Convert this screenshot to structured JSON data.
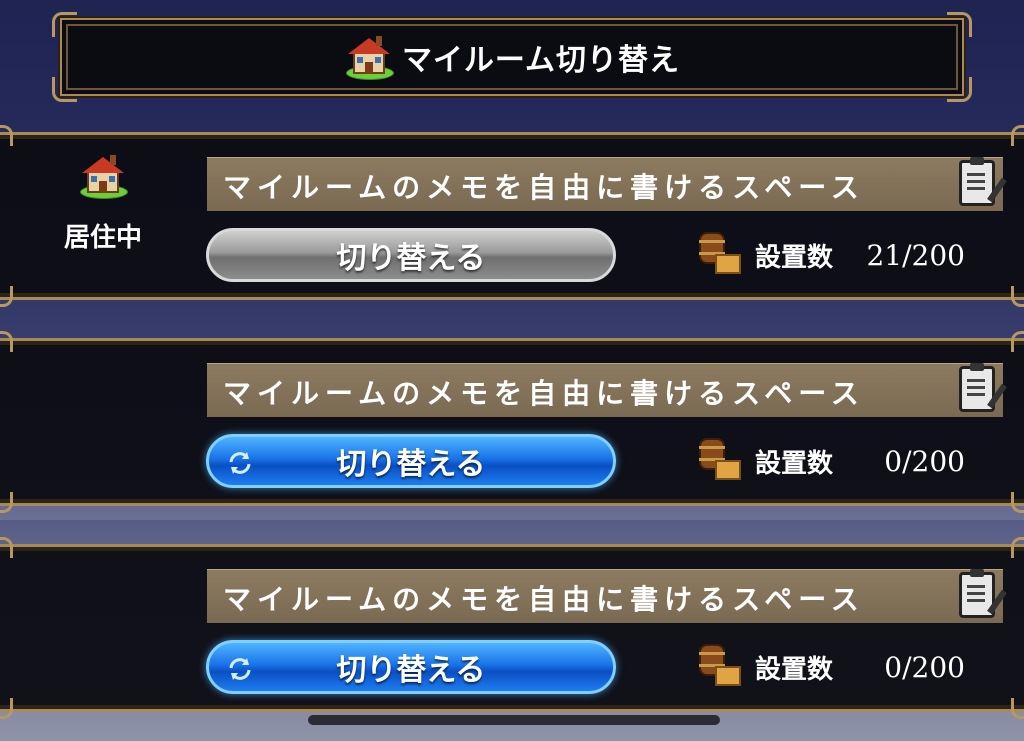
{
  "header": {
    "title": "マイルーム切り替え",
    "icon": "house-icon"
  },
  "rooms": [
    {
      "memo": "マイルームのメモを自由に書けるスペース",
      "status": "居住中",
      "button_label": "切り替える",
      "button_state": "disabled",
      "count_label": "設置数",
      "count_value": "21/200"
    },
    {
      "memo": "マイルームのメモを自由に書けるスペース",
      "status": "",
      "button_label": "切り替える",
      "button_state": "active",
      "count_label": "設置数",
      "count_value": "0/200"
    },
    {
      "memo": "マイルームのメモを自由に書けるスペース",
      "status": "",
      "button_label": "切り替える",
      "button_state": "active",
      "count_label": "設置数",
      "count_value": "0/200"
    }
  ],
  "colors": {
    "frame_gold": "#a88a5a",
    "button_blue": "#1a73e8",
    "button_gray": "#8c8c8c",
    "memo_bg": "#7a6a52"
  }
}
